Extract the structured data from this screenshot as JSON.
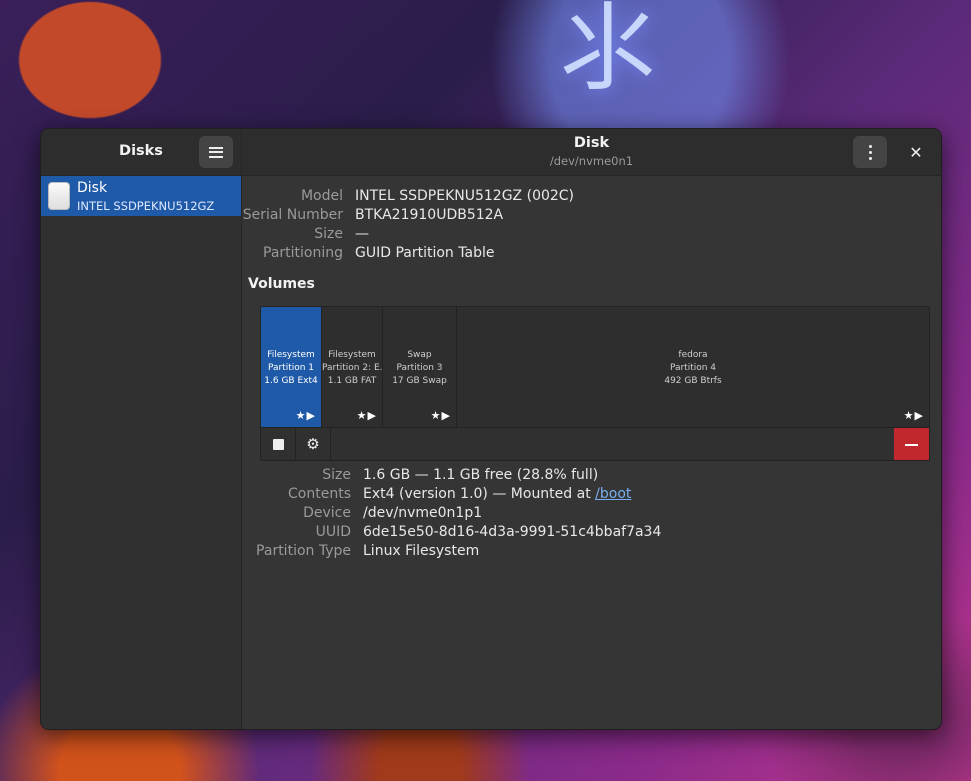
{
  "colors": {
    "accent": "#1f5aa8",
    "destructive": "#c0282d",
    "link": "#78aeed"
  },
  "sidebar": {
    "title": "Disks",
    "menu_icon": "hamburger-menu-icon",
    "items": [
      {
        "label": "Disk",
        "sublabel": "INTEL SSDPEKNU512GZ",
        "icon": "drive-harddisk-icon"
      }
    ]
  },
  "header": {
    "title": "Disk",
    "subtitle": "/dev/nvme0n1",
    "more_icon": "kebab-menu-icon",
    "close_icon": "close-icon",
    "close_glyph": "✕"
  },
  "drive": {
    "model_label": "Model",
    "model": "INTEL SSDPEKNU512GZ (002C)",
    "serial_label": "Serial Number",
    "serial": "BTKA21910UDB512A",
    "size_label": "Size",
    "size": "—",
    "partitioning_label": "Partitioning",
    "partitioning": "GUID Partition Table"
  },
  "volumes_title": "Volumes",
  "volumes": [
    {
      "name": "Filesystem",
      "partition": "Partition 1",
      "info": "1.6 GB Ext4",
      "selected": true
    },
    {
      "name": "Filesystem",
      "partition": "Partition 2: E...",
      "info": "1.1 GB FAT",
      "selected": false
    },
    {
      "name": "Swap",
      "partition": "Partition 3",
      "info": "17 GB Swap",
      "selected": false
    },
    {
      "name": "fedora",
      "partition": "Partition 4",
      "info": "492 GB Btrfs",
      "selected": false
    }
  ],
  "volume_flags": "★▶",
  "toolbar": {
    "unmount_icon": "stop-icon",
    "settings_icon": "gears-icon",
    "settings_glyph": "⚙",
    "delete_icon": "minus-icon"
  },
  "selected_volume": {
    "size_label": "Size",
    "size": "1.6 GB — 1.1 GB free (28.8% full)",
    "contents_label": "Contents",
    "contents_prefix": "Ext4 (version 1.0) — Mounted at ",
    "mount_link": "/boot",
    "device_label": "Device",
    "device": "/dev/nvme0n1p1",
    "uuid_label": "UUID",
    "uuid": "6de15e50-8d16-4d3a-9991-51c4bbaf7a34",
    "ptype_label": "Partition Type",
    "ptype": "Linux Filesystem"
  }
}
